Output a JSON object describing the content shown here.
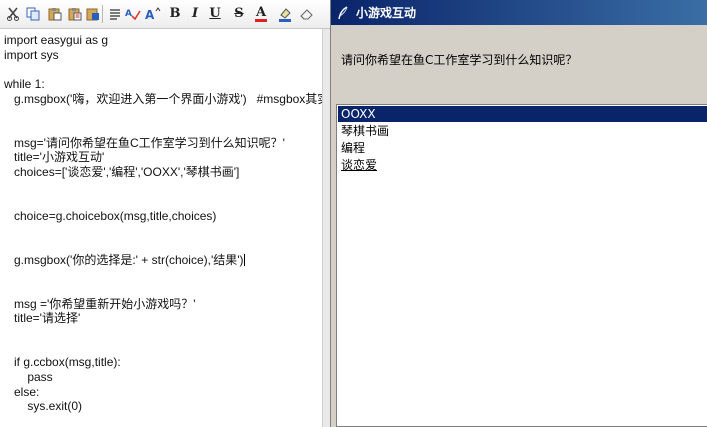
{
  "editor": {
    "toolbar": {
      "buttons": [
        {
          "icon": "cut-icon"
        },
        {
          "icon": "copy-icon"
        },
        {
          "icon": "paste-icon"
        },
        {
          "icon": "paste-text-icon"
        },
        {
          "icon": "list-icon"
        },
        {
          "icon": "spellcheck-icon"
        },
        {
          "icon": "font-size-icon"
        },
        {
          "icon": "bold-icon",
          "label": "B"
        },
        {
          "icon": "italic-icon",
          "label": "I"
        },
        {
          "icon": "underline-icon",
          "label": "U"
        },
        {
          "icon": "strikethrough-icon",
          "label": "S"
        },
        {
          "icon": "text-color-icon",
          "label": "A"
        },
        {
          "icon": "highlight-icon"
        },
        {
          "icon": "eraser-icon"
        }
      ]
    },
    "code_lines": [
      "import easygui as g",
      "import sys",
      "",
      "while 1:",
      "   g.msgbox('嗨，欢迎进入第一个界面小游戏')   #msgbox其实",
      "",
      "",
      "   msg='请问你希望在鱼C工作室学习到什么知识呢？'",
      "   title='小游戏互动'",
      "   choices=['谈恋爱','编程','OOXX','琴棋书画']",
      "",
      "",
      "   choice=g.choicebox(msg,title,choices)",
      "",
      "",
      "   g.msgbox('你的选择是:' + str(choice),'结果')",
      "",
      "",
      "   msg ='你希望重新开始小游戏吗？'",
      "   title='请选择'",
      "",
      "",
      "   if g.ccbox(msg,title):",
      "       pass",
      "   else:",
      "       sys.exit(0)"
    ]
  },
  "dialog": {
    "title": "小游戏互动",
    "prompt": "请问你希望在鱼C工作室学习到什么知识呢？",
    "options": [
      "OOXX",
      "琴棋书画",
      "编程",
      "谈恋爱"
    ],
    "selected_index": 0,
    "colors": {
      "title_bar": "#0a246a",
      "selection": "#0a246a",
      "dialog_bg": "#d4d0c8"
    }
  }
}
